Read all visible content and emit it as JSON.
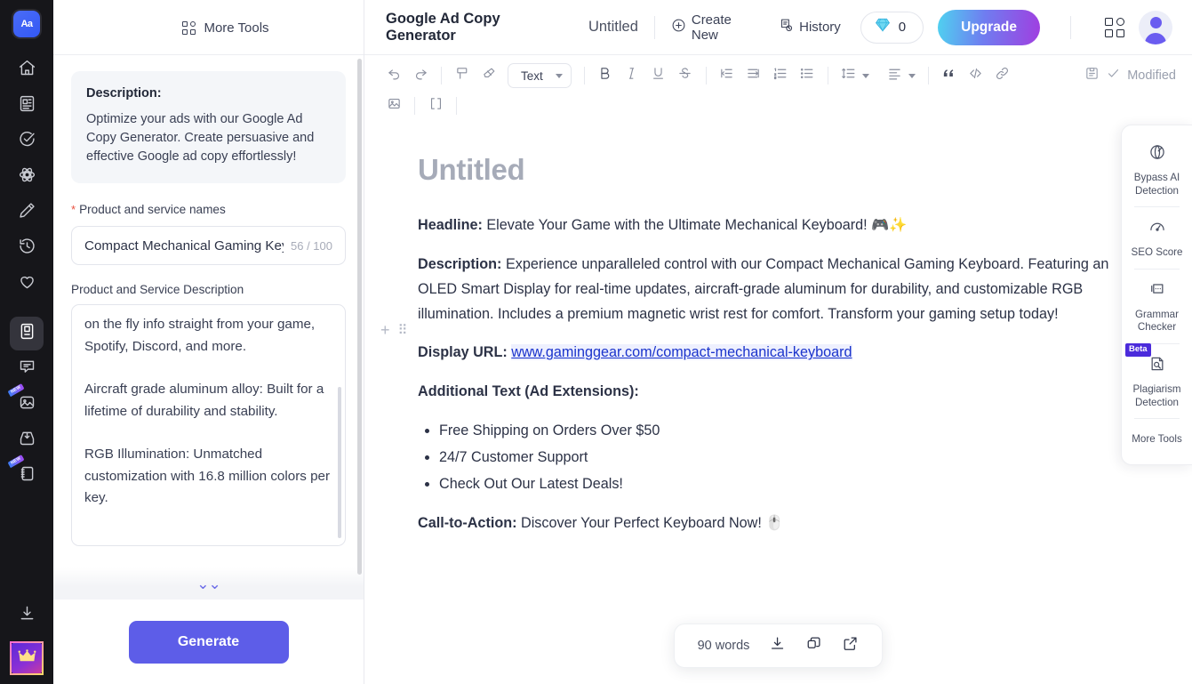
{
  "rail": {
    "logo_label": "Aa",
    "items": [
      {
        "name": "home-icon",
        "badge": null
      },
      {
        "name": "document-icon",
        "badge": null
      },
      {
        "name": "check-circle-icon",
        "badge": null
      },
      {
        "name": "atom-icon",
        "badge": null
      },
      {
        "name": "pencil-icon",
        "badge": null
      },
      {
        "name": "history-icon",
        "badge": null
      },
      {
        "name": "heart-icon",
        "badge": null
      },
      {
        "name": "book-icon",
        "badge": null,
        "active": true
      },
      {
        "name": "chat-icon",
        "badge": null
      },
      {
        "name": "image-icon",
        "badge": "NEW"
      },
      {
        "name": "inbox-icon",
        "badge": null
      },
      {
        "name": "notebook-icon",
        "badge": "NEW"
      }
    ],
    "download_icon": "download-icon",
    "crown_icon": "crown-icon"
  },
  "topbar": {
    "app_title": "Google Ad Copy Generator",
    "doc_name": "Untitled",
    "create_new": "Create New",
    "history": "History",
    "credits": "0",
    "upgrade": "Upgrade"
  },
  "panel": {
    "more_tools": "More Tools",
    "description_title": "Description:",
    "description_body": "Optimize your ads with our Google Ad Copy Generator. Create persuasive and effective Google ad copy effortlessly!",
    "product_label": "Product and service names",
    "product_required": "*",
    "product_value": "Compact Mechanical Gaming Keyboard",
    "product_counter": "56 / 100",
    "desc_label": "Product and Service Description",
    "desc_value": "on the fly info straight from your game, Spotify, Discord, and more.\n\nAircraft grade aluminum alloy: Built for a lifetime of durability and stability.\n\nRGB Illumination: Unmatched customization with 16.8 million colors per key.",
    "generate": "Generate"
  },
  "editor_toolbar": {
    "undo": "undo-icon",
    "redo": "redo-icon",
    "format_paint": "format-paint-icon",
    "clear_format": "eraser-icon",
    "style_value": "Text",
    "bold": "B",
    "italic": "I",
    "underline": "U",
    "strikethrough": "S",
    "modified_label": "Modified"
  },
  "document": {
    "title": "Untitled",
    "headline_label": "Headline:",
    "headline_text": " Elevate Your Game with the Ultimate Mechanical Keyboard! 🎮✨",
    "description_label": "Description:",
    "description_text": " Experience unparalleled control with our Compact Mechanical Gaming Keyboard. Featuring an OLED Smart Display for real-time updates, aircraft-grade aluminum for durability, and customizable RGB illumination. Includes a premium magnetic wrist rest for comfort. Transform your gaming setup today!",
    "url_label": "Display URL:",
    "url_text": "www.gaminggear.com/compact-mechanical-keyboard",
    "additional_label": "Additional Text (Ad Extensions):",
    "bullets": [
      "Free Shipping on Orders Over $50",
      "24/7 Customer Support",
      "Check Out Our Latest Deals!"
    ],
    "cta_label": "Call-to-Action:",
    "cta_text": " Discover Your Perfect Keyboard Now! 🖱️"
  },
  "right_tools": [
    {
      "label": "Bypass AI Detection",
      "icon": "bypass-ai-icon",
      "badge": null
    },
    {
      "label": "SEO Score",
      "icon": "seo-score-icon",
      "badge": null
    },
    {
      "label": "Grammar Checker",
      "icon": "grammar-checker-icon",
      "badge": null
    },
    {
      "label": "Plagiarism Detection",
      "icon": "plagiarism-icon",
      "badge": "Beta"
    },
    {
      "label": "More Tools",
      "icon": null,
      "badge": null
    }
  ],
  "statusbar": {
    "word_count": "90 words",
    "download": "download-icon",
    "copy": "copy-icon",
    "share": "share-icon"
  },
  "colors": {
    "accent_purple": "#5d5de8",
    "rail_bg": "#16161a",
    "link": "#1a33cc",
    "beta_badge": "#4b2bdb",
    "required": "#e8513f"
  }
}
